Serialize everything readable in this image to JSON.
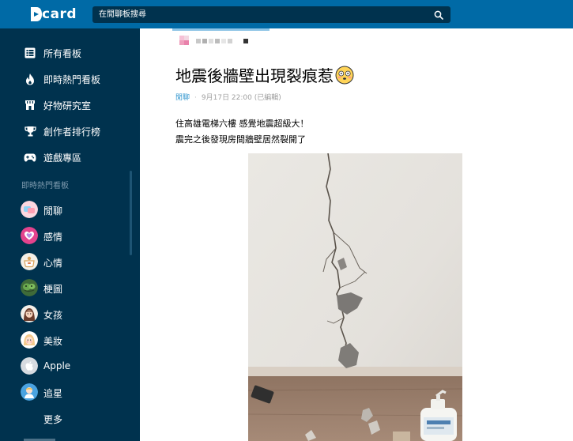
{
  "header": {
    "logo_text": "card",
    "search_placeholder": "在閒聊板搜尋"
  },
  "sidebar": {
    "nav": [
      {
        "label": "所有看板",
        "icon": "list-icon"
      },
      {
        "label": "即時熱門看板",
        "icon": "fire-icon"
      },
      {
        "label": "好物研究室",
        "icon": "store-icon"
      },
      {
        "label": "創作者排行榜",
        "icon": "trophy-icon"
      },
      {
        "label": "遊戲專區",
        "icon": "gamepad-icon"
      }
    ],
    "section_title": "即時熱門看板",
    "boards": [
      {
        "label": "閒聊"
      },
      {
        "label": "感情"
      },
      {
        "label": "心情"
      },
      {
        "label": "梗圖"
      },
      {
        "label": "女孩"
      },
      {
        "label": "美妝"
      },
      {
        "label": "Apple"
      },
      {
        "label": "追星"
      }
    ],
    "more_label": "更多"
  },
  "post": {
    "title": "地震後牆壁出現裂痕惹",
    "forum": "閒聊",
    "timestamp": "9月17日 22:00 (已編輯)",
    "body_lines": [
      "住高雄電梯六樓 感覺地震超級大！",
      "震完之後發現房間牆壁居然裂開了"
    ]
  },
  "colors": {
    "topbar": "#006aa6",
    "sidebar": "#00324e",
    "search": "#00324e",
    "link": "#3397cf"
  }
}
